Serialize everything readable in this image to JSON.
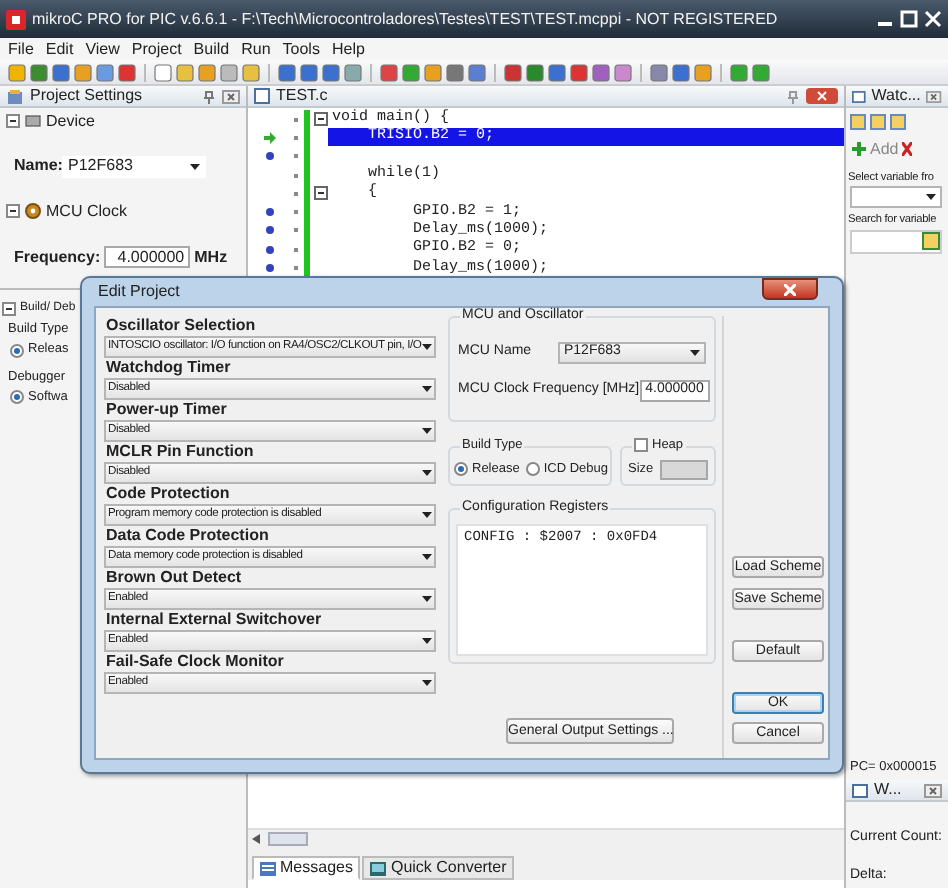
{
  "window": {
    "title": "mikroC PRO for PIC v.6.6.1 - F:\\Tech\\Microcontroladores\\Testes\\TEST\\TEST.mcppi - NOT REGISTERED"
  },
  "menu": [
    "File",
    "Edit",
    "View",
    "Project",
    "Build",
    "Run",
    "Tools",
    "Help"
  ],
  "project_settings": {
    "title": "Project Settings",
    "device_section": "Device",
    "name_label": "Name:",
    "name_value": "P12F683",
    "clock_section": "MCU Clock",
    "frequency_label": "Frequency:",
    "frequency_value": "4.000000",
    "frequency_unit": "MHz",
    "build_section": "Build/ Deb",
    "build_type_label": "Build Type",
    "build_type_option": {
      "label": "Releas",
      "selected": true
    },
    "debugger_label": "Debugger",
    "debugger_option": {
      "label": "Softwa",
      "selected": true
    }
  },
  "editor": {
    "tab": "TEST.c",
    "lines": [
      {
        "text": "void main() {",
        "fold": true,
        "executing": false,
        "breakpoint": false
      },
      {
        "text": "    TRISIO.B2 = 0;",
        "highlighted": true,
        "fold": false,
        "executing": true,
        "breakpoint": false
      },
      {
        "fold": false,
        "executing": false,
        "breakpoint": true
      },
      {
        "text": "    while(1)",
        "fold": false,
        "executing": false,
        "breakpoint": false
      },
      {
        "text": "    {",
        "fold": true,
        "executing": false,
        "breakpoint": false
      },
      {
        "text": "         GPIO.B2 = 1;",
        "fold": false,
        "executing": false,
        "breakpoint": true
      },
      {
        "text": "         Delay_ms(1000);",
        "fold": false,
        "executing": false,
        "breakpoint": true
      },
      {
        "text": "         GPIO.B2 = 0;",
        "fold": false,
        "executing": false,
        "breakpoint": true
      },
      {
        "text": "         Delay_ms(1000);",
        "fold": false,
        "executing": false,
        "breakpoint": true
      }
    ]
  },
  "watch": {
    "title": "Watc...",
    "add": "Add",
    "select_label": "Select variable fro",
    "search_label": "Search for variable",
    "pc": "PC= 0x000015",
    "panel2_title": "W...",
    "current_count": "Current Count:",
    "delta": "Delta:"
  },
  "bottom_tabs": [
    {
      "label": "Messages",
      "selected": true
    },
    {
      "label": "Quick Converter",
      "selected": false
    }
  ],
  "dialog": {
    "title": "Edit Project",
    "config_fields": [
      {
        "label": "Oscillator Selection",
        "value": "INTOSCIO oscillator: I/O function on RA4/OSC2/CLKOUT pin, I/O"
      },
      {
        "label": "Watchdog Timer",
        "value": "Disabled"
      },
      {
        "label": "Power-up Timer",
        "value": "Disabled"
      },
      {
        "label": "MCLR Pin Function",
        "value": "Disabled"
      },
      {
        "label": "Code Protection",
        "value": "Program memory code protection is disabled"
      },
      {
        "label": "Data Code Protection",
        "value": "Data memory code protection is disabled"
      },
      {
        "label": "Brown Out Detect",
        "value": "Enabled"
      },
      {
        "label": "Internal External Switchover",
        "value": "Enabled"
      },
      {
        "label": "Fail-Safe Clock Monitor",
        "value": "Enabled"
      }
    ],
    "mcu_group": {
      "title": "MCU and Oscillator",
      "name_label": "MCU Name",
      "name_value": "P12F683",
      "freq_label": "MCU Clock Frequency [MHz]",
      "freq_value": "4.000000"
    },
    "build_type": {
      "title": "Build Type",
      "options": [
        {
          "label": "Release",
          "selected": true
        },
        {
          "label": "ICD Debug",
          "selected": false
        }
      ]
    },
    "heap": {
      "label": "Heap",
      "checked": false,
      "size_label": "Size",
      "size_disabled": true
    },
    "config_registers": {
      "title": "Configuration Registers",
      "text": "CONFIG : $2007 : 0x0FD4"
    },
    "side_buttons": [
      {
        "label": "Load Scheme",
        "default": false
      },
      {
        "label": "Save Scheme",
        "default": false
      },
      {
        "label": "Default",
        "default": false
      },
      {
        "label": "OK",
        "default": true
      },
      {
        "label": "Cancel",
        "default": false
      }
    ],
    "output_button": "General Output Settings ..."
  }
}
